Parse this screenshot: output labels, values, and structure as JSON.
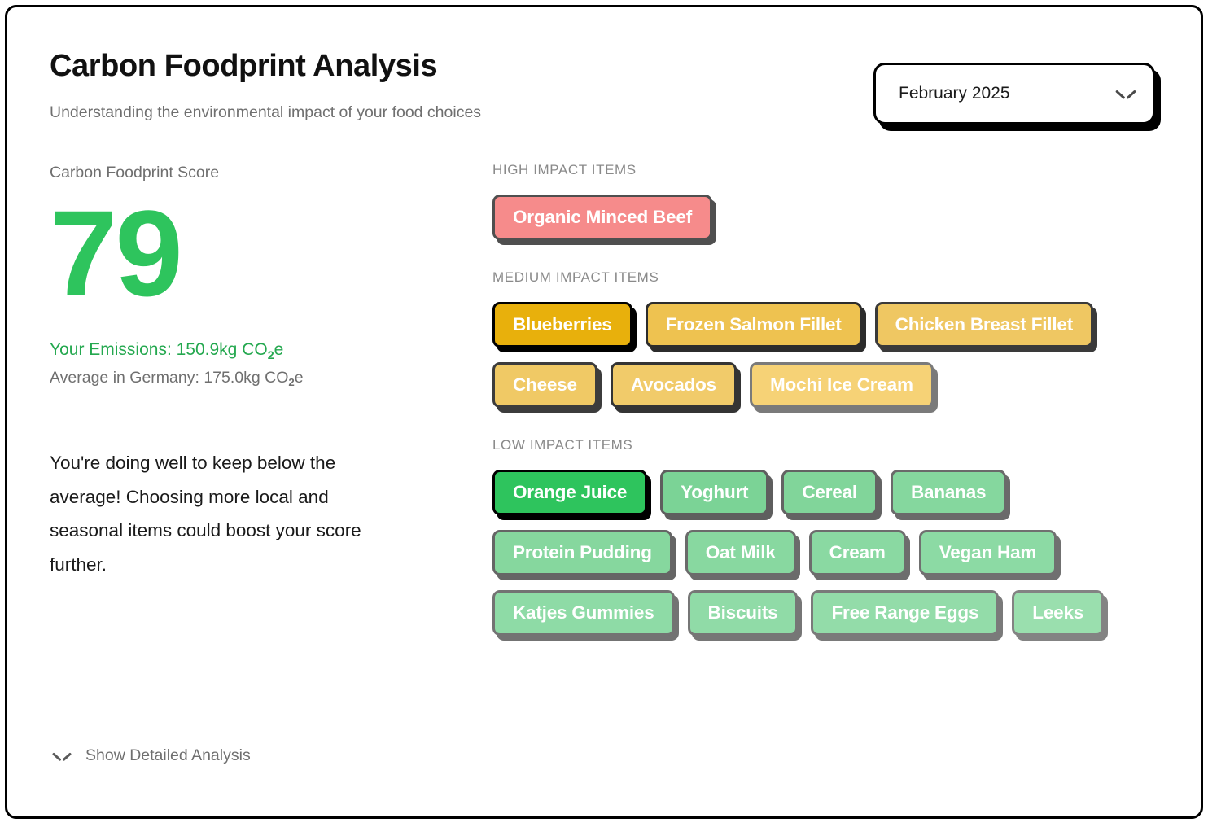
{
  "header": {
    "title": "Carbon Foodprint Analysis",
    "subtitle": "Understanding the environmental impact of your food choices"
  },
  "month_select": {
    "value": "February 2025",
    "icon": "chevron-down-icon"
  },
  "score_panel": {
    "label": "Carbon Foodprint Score",
    "score": "79",
    "emissions_prefix": "Your Emissions: 150.9kg CO",
    "emissions_sub": "2",
    "emissions_suffix": "e",
    "average_prefix": "Average in Germany: 175.0kg CO",
    "average_sub": "2",
    "average_suffix": "e",
    "advice": "You're doing well to keep below the average! Choosing more local and seasonal items could boost your score further."
  },
  "show_detail": {
    "label": "Show Detailed Analysis",
    "icon": "chevron-down-icon"
  },
  "colors": {
    "score_green": "#2ec45d",
    "emissions_green": "#24a84f",
    "high_impact": "#f68b8b",
    "medium_impact_strong": "#e8b00c",
    "medium_impact_light": "#f6d276",
    "low_impact_strong": "#2ec45d",
    "low_impact_light": "#9fdcb2",
    "muted_text": "#6f6f6f",
    "group_title": "#8a8a8a",
    "card_border": "#000000"
  },
  "groups": [
    {
      "title": "HIGH IMPACT ITEMS",
      "items": [
        {
          "label": "Organic Minced Beef",
          "bg": "#f68b8b",
          "border": "#4f4f4f",
          "shadow": "#4f4f4f"
        }
      ]
    },
    {
      "title": "MEDIUM IMPACT ITEMS",
      "items": [
        {
          "label": "Blueberries",
          "bg": "#e8b00c",
          "border": "#000000",
          "shadow": "#000000"
        },
        {
          "label": "Frozen Salmon Fillet",
          "bg": "#eec250",
          "border": "#2c2c2c",
          "shadow": "#2c2c2c"
        },
        {
          "label": "Chicken Breast Fillet",
          "bg": "#efc762",
          "border": "#3a3a3a",
          "shadow": "#3a3a3a"
        },
        {
          "label": "Cheese",
          "bg": "#f0c965",
          "border": "#3c3c3c",
          "shadow": "#3c3c3c"
        },
        {
          "label": "Avocados",
          "bg": "#f1cb6a",
          "border": "#343434",
          "shadow": "#343434"
        },
        {
          "label": "Mochi Ice Cream",
          "bg": "#f6d276",
          "border": "#7a7a7a",
          "shadow": "#7a7a7a"
        }
      ]
    },
    {
      "title": "LOW IMPACT ITEMS",
      "items": [
        {
          "label": "Orange Juice",
          "bg": "#2ec45d",
          "border": "#000000",
          "shadow": "#000000"
        },
        {
          "label": "Yoghurt",
          "bg": "#7bd396",
          "border": "#5e5e5e",
          "shadow": "#5e5e5e"
        },
        {
          "label": "Cereal",
          "bg": "#81d59a",
          "border": "#636363",
          "shadow": "#636363"
        },
        {
          "label": "Bananas",
          "bg": "#85d79e",
          "border": "#6a6a6a",
          "shadow": "#6a6a6a"
        },
        {
          "label": "Protein Pudding",
          "bg": "#86d79e",
          "border": "#656565",
          "shadow": "#656565"
        },
        {
          "label": "Oat Milk",
          "bg": "#88d8a0",
          "border": "#6b6b6b",
          "shadow": "#6b6b6b"
        },
        {
          "label": "Cream",
          "bg": "#8ad9a2",
          "border": "#6d6d6d",
          "shadow": "#6d6d6d"
        },
        {
          "label": "Vegan Ham",
          "bg": "#8cdaa4",
          "border": "#707070",
          "shadow": "#707070"
        },
        {
          "label": "Katjes Gummies",
          "bg": "#8edba6",
          "border": "#737373",
          "shadow": "#737373"
        },
        {
          "label": "Biscuits",
          "bg": "#90dba7",
          "border": "#767676",
          "shadow": "#767676"
        },
        {
          "label": "Free Range Eggs",
          "bg": "#93dca9",
          "border": "#7a7a7a",
          "shadow": "#7a7a7a"
        },
        {
          "label": "Leeks",
          "bg": "#9adfae",
          "border": "#838383",
          "shadow": "#838383"
        }
      ]
    }
  ]
}
